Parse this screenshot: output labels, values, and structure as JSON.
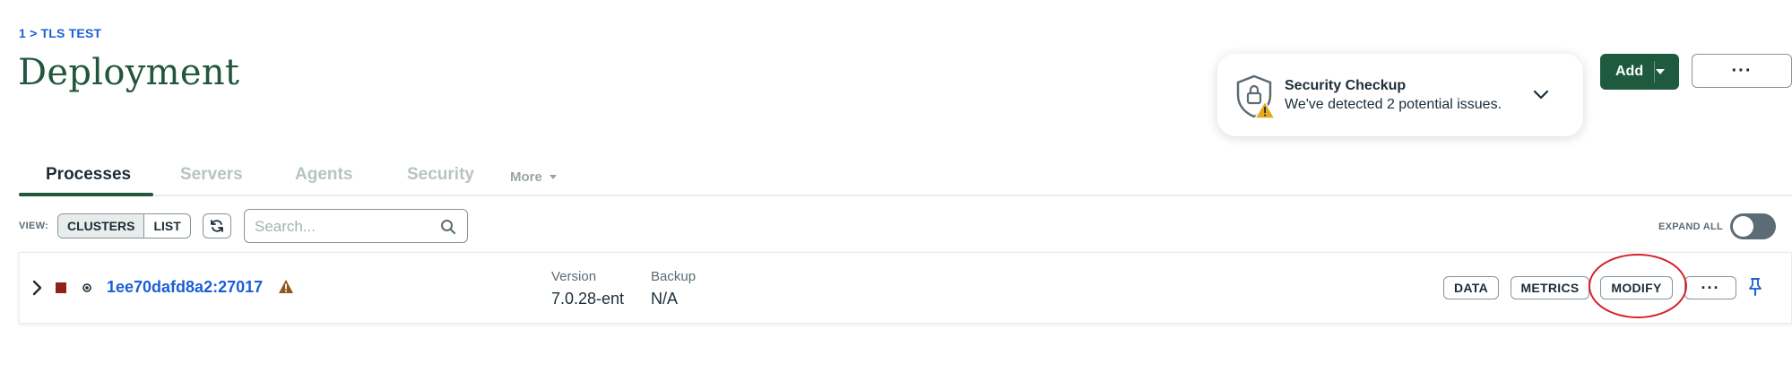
{
  "breadcrumb": "1 > TLS TEST",
  "page_title": "Deployment",
  "security_checkup": {
    "title": "Security Checkup",
    "subtitle": "We've detected 2 potential issues."
  },
  "header": {
    "add_label": "Add",
    "menu_label": "···"
  },
  "tabs": [
    {
      "label": "Processes"
    },
    {
      "label": "Servers"
    },
    {
      "label": "Agents"
    },
    {
      "label": "Security"
    },
    {
      "label": "More"
    }
  ],
  "toolbar": {
    "view_label": "VIEW:",
    "view_options": [
      "CLUSTERS",
      "LIST"
    ],
    "search_placeholder": "Search...",
    "expand_all_label": "EXPAND ALL"
  },
  "cluster": {
    "name": "1ee70dafd8a2:27017",
    "version_label": "Version",
    "version_value": "7.0.28-ent",
    "backup_label": "Backup",
    "backup_value": "N/A",
    "actions": [
      "DATA",
      "METRICS",
      "MODIFY"
    ],
    "menu_label": "···"
  },
  "colors": {
    "brand_green": "#1e5b3e",
    "title_green": "#21573d",
    "link_blue": "#1a5fd6",
    "status_red": "#8f221b",
    "warning_amber": "#e6a81f",
    "highlight_red": "#d8202b"
  },
  "icons": [
    "shield-lock-icon",
    "warning-icon",
    "chevron-down-icon",
    "refresh-icon",
    "search-icon",
    "chevron-right-icon",
    "pin-icon"
  ]
}
